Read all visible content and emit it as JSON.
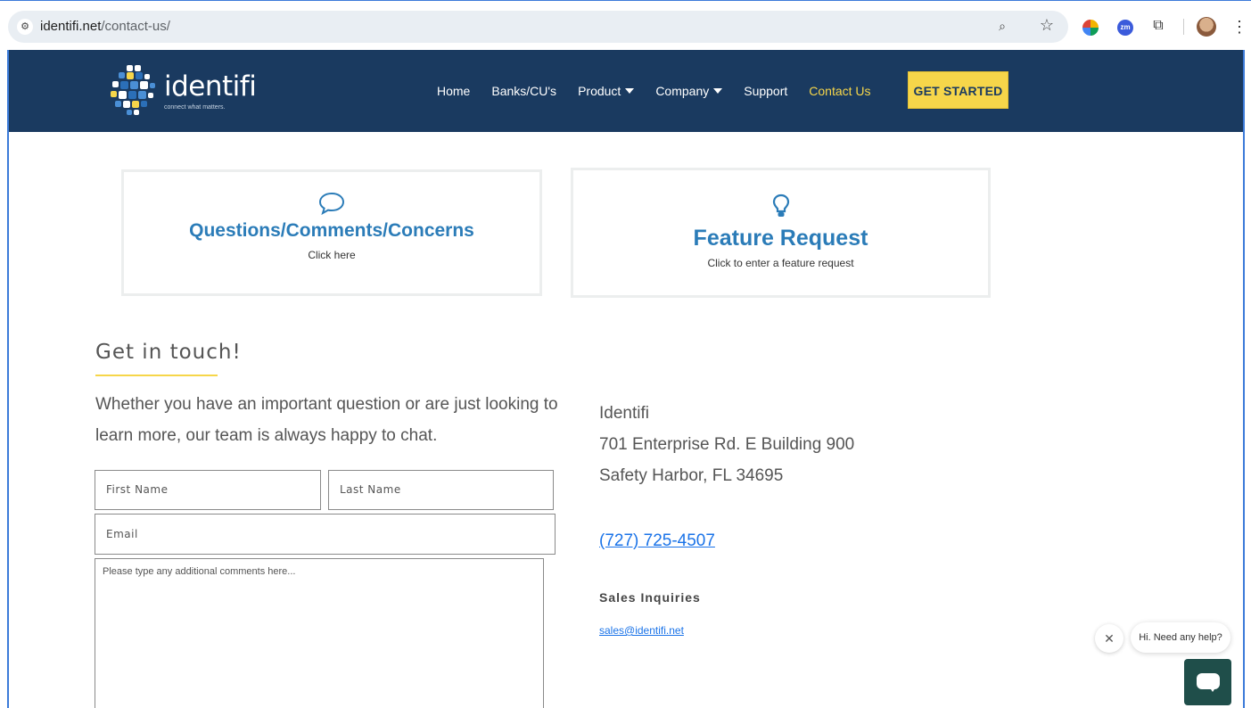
{
  "browser": {
    "url_host": "identifi.net",
    "url_path": "/contact-us/"
  },
  "header": {
    "logo_word": "identifi",
    "logo_tagline": "connect what matters.",
    "nav": [
      {
        "label": "Home",
        "dropdown": false,
        "active": false
      },
      {
        "label": "Banks/CU's",
        "dropdown": false,
        "active": false
      },
      {
        "label": "Product",
        "dropdown": true,
        "active": false
      },
      {
        "label": "Company",
        "dropdown": true,
        "active": false
      },
      {
        "label": "Support",
        "dropdown": false,
        "active": false
      },
      {
        "label": "Contact Us",
        "dropdown": false,
        "active": true
      }
    ],
    "cta_label": "GET STARTED"
  },
  "cards": [
    {
      "icon": "speech-bubble-icon",
      "title": "Questions/Comments/Concerns",
      "subtitle": "Click here"
    },
    {
      "icon": "lightbulb-icon",
      "title": "Feature Request",
      "subtitle": "Click to enter a feature request"
    }
  ],
  "touch": {
    "heading": "Get in touch!",
    "copy": "Whether you have an important question or are just looking to learn more, our team is always happy to chat."
  },
  "form": {
    "first_name_placeholder": "First Name",
    "last_name_placeholder": "Last Name",
    "email_placeholder": "Email",
    "comments_placeholder": "Please type any additional comments here..."
  },
  "contact": {
    "company": "Identifi",
    "address_line1": "701 Enterprise Rd. E Building 900",
    "address_line2": "Safety Harbor, FL 34695",
    "phone": "(727) 725-4507",
    "sales_title": "Sales Inquiries",
    "sales_email": "sales@identifi.net"
  },
  "chat": {
    "greeting": "Hi. Need any help?",
    "close_glyph": "✕"
  },
  "colors": {
    "header_bg": "#1a3a60",
    "accent_yellow": "#f6d64a",
    "card_blue": "#2b7cb8",
    "link_blue": "#1a73e8",
    "chat_green": "#1f4e4a"
  }
}
